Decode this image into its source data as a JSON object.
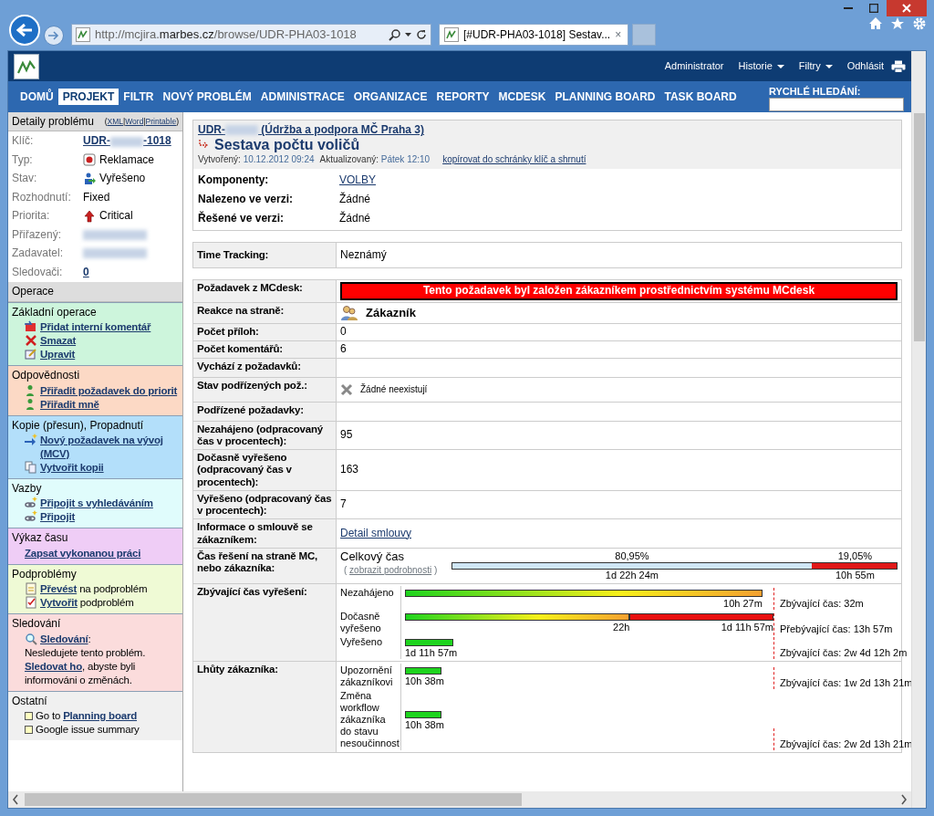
{
  "browser": {
    "address": "http://mcjira.**marbes.cz**/browse/UDR-PHA03-1018",
    "tab_title": "[#UDR-PHA03-1018] Sestav...",
    "tab_close": "×"
  },
  "header": {
    "user": "Administrator",
    "menus": [
      {
        "label": "Historie"
      },
      {
        "label": "Filtry"
      }
    ],
    "logout": "Odhlásit"
  },
  "nav": {
    "items": [
      {
        "label": "DOMŮ",
        "selected": false
      },
      {
        "label": "PROJEKT",
        "selected": true
      },
      {
        "label": "FILTR",
        "selected": false
      },
      {
        "label": "NOVÝ PROBLÉM",
        "selected": false
      },
      {
        "label": "ADMINISTRACE",
        "selected": false
      },
      {
        "label": "ORGANIZACE",
        "selected": false
      },
      {
        "label": "REPORTY",
        "selected": false
      },
      {
        "label": "MCDESK",
        "selected": false
      },
      {
        "label": "PLANNING BOARD",
        "selected": false
      },
      {
        "label": "TASK BOARD",
        "selected": false
      }
    ],
    "search_label": "RYCHLÉ HLEDÁNÍ:"
  },
  "details": {
    "title": "Detaily problému",
    "export": {
      "open": "(",
      "separator": "|",
      "close": ")",
      "links": [
        "XML",
        "Word",
        "Printable"
      ]
    },
    "fields": [
      {
        "label": "Klíč:",
        "kind": "key",
        "prefix": "UDR-",
        "suffix": "-1018"
      },
      {
        "label": "Typ:",
        "kind": "type",
        "value": "Reklamace"
      },
      {
        "label": "Stav:",
        "kind": "status",
        "value": "Vyřešeno"
      },
      {
        "label": "Rozhodnutí:",
        "kind": "text",
        "value": "Fixed"
      },
      {
        "label": "Priorita:",
        "kind": "priority",
        "value": "Critical"
      },
      {
        "label": "Přiřazený:",
        "kind": "redacted"
      },
      {
        "label": "Zadavatel:",
        "kind": "redacted"
      },
      {
        "label": "Sledovači:",
        "kind": "link",
        "value": "0"
      }
    ]
  },
  "operations": {
    "title": "Operace",
    "sections": [
      {
        "title": "Základní operace",
        "color": "#cdf5dc",
        "items": [
          {
            "kind": "comment",
            "parts": [
              {
                "text": "Přidat interní komentář",
                "link": true
              }
            ]
          },
          {
            "kind": "delete",
            "parts": [
              {
                "text": "Smazat",
                "link": true
              }
            ]
          },
          {
            "kind": "edit",
            "parts": [
              {
                "text": "Upravit",
                "link": true
              }
            ]
          }
        ]
      },
      {
        "title": "Odpovědnosti",
        "color": "#fcd9c5",
        "items": [
          {
            "kind": "assign",
            "parts": [
              {
                "text": "Přiřadit požadavek do priorit",
                "link": true
              }
            ]
          },
          {
            "kind": "assign",
            "parts": [
              {
                "text": "Přiřadit mně",
                "link": true
              }
            ]
          }
        ]
      },
      {
        "title": "Kopie (přesun), Propadnutí",
        "color": "#b3dffa",
        "items": [
          {
            "kind": "new",
            "parts": [
              {
                "text": "Nový požadavek na vývoj (MCV)",
                "link": true
              }
            ]
          },
          {
            "kind": "copy",
            "parts": [
              {
                "text": "Vytvořit kopii",
                "link": true
              }
            ]
          }
        ]
      },
      {
        "title": "Vazby",
        "color": "#e0fcfc",
        "items": [
          {
            "kind": "chain",
            "parts": [
              {
                "text": "Připojit s vyhledáváním",
                "link": true
              }
            ]
          },
          {
            "kind": "chain",
            "parts": [
              {
                "text": "Připojit",
                "link": true
              }
            ]
          }
        ]
      },
      {
        "title": "Výkaz času",
        "color": "#efcdf6",
        "items": [
          {
            "kind": "plain",
            "parts": [
              {
                "text": "Zapsat vykonanou práci",
                "link": true
              }
            ]
          }
        ]
      },
      {
        "title": "Podproblémy",
        "color": "#effad5",
        "items": [
          {
            "kind": "convert",
            "parts": [
              {
                "text": "Převést",
                "link": true
              },
              {
                "text": " na podproblém",
                "link": false
              }
            ]
          },
          {
            "kind": "create",
            "parts": [
              {
                "text": "Vytvořit",
                "link": true
              },
              {
                "text": " podproblém",
                "link": false
              }
            ]
          }
        ]
      },
      {
        "title": "Sledování",
        "color": "#fbdcdc",
        "items": [
          {
            "kind": "watch",
            "parts": [
              {
                "text": "Sledování",
                "link": true
              },
              {
                "text": ":",
                "link": false
              }
            ]
          },
          {
            "kind": "text",
            "parts": [
              {
                "text": "Nesledujete tento problém. ",
                "link": false
              },
              {
                "text": "Sledovat ho",
                "link": true
              },
              {
                "text": ", abyste byli informováni o změnách.",
                "link": false
              }
            ]
          }
        ]
      },
      {
        "title": "Ostatní",
        "color": "#f0f0f0",
        "items": [
          {
            "kind": "square",
            "parts": [
              {
                "text": "Go to ",
                "link": false
              },
              {
                "text": "Planning board",
                "link": true
              }
            ]
          },
          {
            "kind": "square",
            "parts": [
              {
                "text": "Google issue summary",
                "link": false
              }
            ]
          }
        ]
      }
    ]
  },
  "issue": {
    "project_prefix": "UDR-",
    "project_name": "(Údržba a podpora MČ Praha 3)",
    "title": "Sestava počtu voličů",
    "meta": [
      {
        "label": "Vytvořený:",
        "value": "10.12.2012 09:24"
      },
      {
        "label": "Aktualizovaný:",
        "value": "Pátek 12:10"
      }
    ],
    "copy_link": "kopírovat do schránky klíč a shrnutí",
    "fields": [
      {
        "label": "Komponenty:",
        "kind": "link",
        "value": "VOLBY"
      },
      {
        "label": "Nalezeno ve verzi:",
        "kind": "text",
        "value": "Žádné"
      },
      {
        "label": "Řešené ve verzi:",
        "kind": "text",
        "value": "Žádné"
      }
    ]
  },
  "time_tracking": {
    "label": "Time Tracking:",
    "value": "Neznámý"
  },
  "mcdesk": {
    "rows": [
      {
        "kind": "banner",
        "label": "Požadavek z MCdesk:",
        "value": "Tento požadavek byl založen zákazníkem prostřednictvím systému MCdesk"
      },
      {
        "kind": "person",
        "label": "Reakce na straně:",
        "value": "Zákazník"
      },
      {
        "kind": "text",
        "label": "Počet příloh:",
        "value": "0"
      },
      {
        "kind": "text",
        "label": "Počet komentářů:",
        "value": "6"
      },
      {
        "kind": "text",
        "label": "Vychází z požadavků:"
      },
      {
        "kind": "none",
        "label": "Stav podřízených pož.:",
        "value": "Žádné neexistují"
      },
      {
        "kind": "text",
        "label": "Podřízené požadavky:"
      },
      {
        "kind": "text",
        "label": "Nezahájeno (odpracovaný čas v procentech):",
        "value": "95"
      },
      {
        "kind": "text",
        "label": "Dočasně vyřešeno (odpracovaný čas v procentech):",
        "value": "163"
      },
      {
        "kind": "text",
        "label": "Vyřešeno (odpracovaný čas v procentech):",
        "value": "7"
      },
      {
        "kind": "link",
        "label": "Informace o smlouvě se zákazníkem:",
        "value": "Detail smlouvy"
      },
      {
        "kind": "total",
        "label": "Čas řešení na straně MC, nebo zákazníka:",
        "title": "Celkový čas",
        "details_open": "(",
        "details_link": "zobrazit podrobnosti",
        "details_close": ")",
        "segments": [
          {
            "kind": "mc",
            "level": 0.8095,
            "percent": "80,95%",
            "time": "1d 22h 24m"
          },
          {
            "kind": "customer",
            "level": 0.1905,
            "percent": "19,05%",
            "time": "10h 55m"
          }
        ]
      },
      {
        "kind": "bars",
        "label": "Zbývající čas vyřešení:",
        "bars": [
          {
            "name": "Nezahájeno",
            "segments": [
              {
                "kind": "gradient",
                "level": 0.97,
                "time": "10h 27m"
              }
            ],
            "note": "Zbývající čas: 32m"
          },
          {
            "name": "Dočasně vyřešeno",
            "segments": [
              {
                "kind": "gradient",
                "level": 0.61,
                "time": "22h"
              },
              {
                "kind": "overdue",
                "level": 0.39,
                "time": "1d 11h 57m"
              }
            ],
            "note": "Přebývající čas: 13h 57m"
          },
          {
            "name": "Vyřešeno",
            "segments": [
              {
                "kind": "green",
                "level": 0.13,
                "time": "1d 11h 57m"
              }
            ],
            "note": "Zbývající čas: 2w 4d 12h 2m"
          }
        ]
      },
      {
        "kind": "bars",
        "label": "Lhůty zákazníka:",
        "bars": [
          {
            "name": "Upozornění zákazníkovi",
            "segments": [
              {
                "kind": "green",
                "level": 0.1,
                "time": "10h 38m"
              }
            ],
            "note": "Zbývající čas: 1w 2d 13h 21m"
          },
          {
            "name": "Změna workflow zákazníka do stavu nesoučinnost",
            "segments": [
              {
                "kind": "green",
                "level": 0.1,
                "time": "10h 38m"
              }
            ],
            "note": "Zbývající čas: 2w 2d 13h 21m"
          }
        ]
      }
    ]
  }
}
